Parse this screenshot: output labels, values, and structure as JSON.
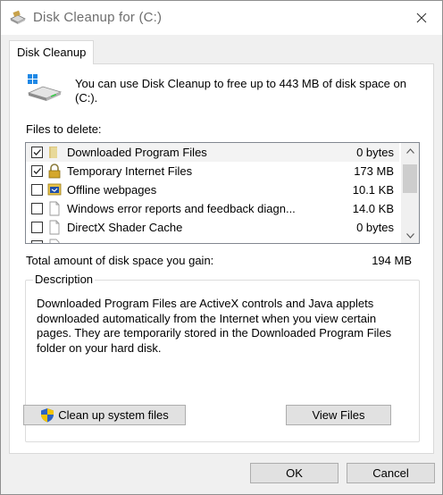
{
  "window": {
    "title": "Disk Cleanup for  (C:)"
  },
  "tab": {
    "label": "Disk Cleanup"
  },
  "intro": {
    "text": "You can use Disk Cleanup to free up to 443 MB of disk space on (C:)."
  },
  "files": {
    "label": "Files to delete:",
    "items": [
      {
        "name": "Downloaded Program Files",
        "size": "0 bytes",
        "checked": true,
        "icon": "folder-icon"
      },
      {
        "name": "Temporary Internet Files",
        "size": "173 MB",
        "checked": true,
        "icon": "lock-icon"
      },
      {
        "name": "Offline webpages",
        "size": "10.1 KB",
        "checked": false,
        "icon": "offline-webpage-icon"
      },
      {
        "name": "Windows error reports and feedback diagn...",
        "size": "14.0 KB",
        "checked": false,
        "icon": "file-icon"
      },
      {
        "name": "DirectX Shader Cache",
        "size": "0 bytes",
        "checked": false,
        "icon": "file-icon"
      }
    ]
  },
  "total": {
    "label": "Total amount of disk space you gain:",
    "value": "194 MB"
  },
  "description": {
    "legend": "Description",
    "text": "Downloaded Program Files are ActiveX controls and Java applets downloaded automatically from the Internet when you view certain pages. They are temporarily stored in the Downloaded Program Files folder on your hard disk."
  },
  "buttons": {
    "cleanup": "Clean up system files",
    "view": "View Files",
    "ok": "OK",
    "cancel": "Cancel"
  },
  "colors": {
    "accent": "#0078d7",
    "shield_blue": "#2b62c4",
    "shield_yellow": "#f4c400"
  }
}
